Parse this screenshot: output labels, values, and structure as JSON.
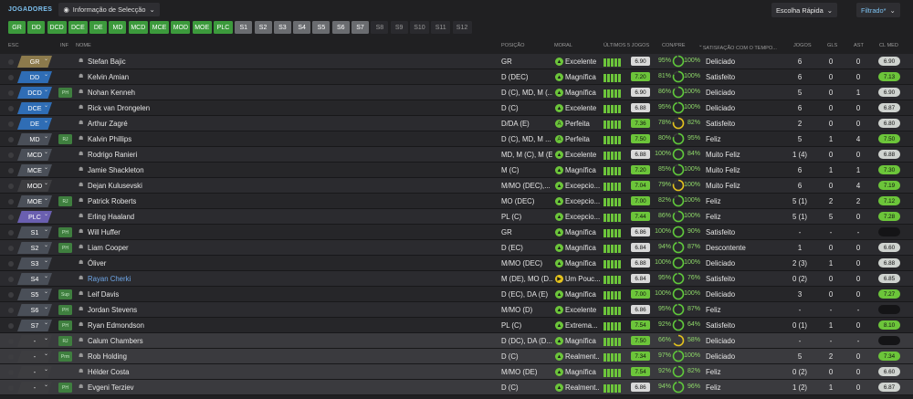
{
  "header": {
    "title": "JOGADORES",
    "view_label": "Informação de Selecção",
    "quick_pick": "Escolha Rápida",
    "filter": "Filtrado*"
  },
  "position_chips": [
    {
      "label": "GR",
      "style": "on"
    },
    {
      "label": "DD",
      "style": "on"
    },
    {
      "label": "DCD",
      "style": "on"
    },
    {
      "label": "DCE",
      "style": "on"
    },
    {
      "label": "DE",
      "style": "on"
    },
    {
      "label": "MD",
      "style": "on"
    },
    {
      "label": "MCD",
      "style": "on"
    },
    {
      "label": "MCE",
      "style": "on"
    },
    {
      "label": "MOD",
      "style": "on"
    },
    {
      "label": "MOE",
      "style": "on"
    },
    {
      "label": "PLC",
      "style": "on"
    },
    {
      "label": "S1",
      "style": "gr"
    },
    {
      "label": "S2",
      "style": "gr"
    },
    {
      "label": "S3",
      "style": "gr"
    },
    {
      "label": "S4",
      "style": "gr"
    },
    {
      "label": "S5",
      "style": "gr"
    },
    {
      "label": "S6",
      "style": "gr"
    },
    {
      "label": "S7",
      "style": "gr"
    },
    {
      "label": "S8",
      "style": "off"
    },
    {
      "label": "S9",
      "style": "off"
    },
    {
      "label": "S10",
      "style": "off"
    },
    {
      "label": "S11",
      "style": "off"
    },
    {
      "label": "S12",
      "style": "off"
    }
  ],
  "columns": {
    "esc": "ESC",
    "inf": "INF",
    "nome": "NOME",
    "posicao": "POSIÇÃO",
    "moral": "MORAL",
    "ultimos": "ÚLTIMOS 5 JOGOS",
    "conpre": "CON/PRE",
    "satisfacao": "SATISFAÇÃO COM O TEMPO...",
    "jogos": "JOGOS",
    "gls": "GLS",
    "ast": "AST",
    "clmed": "CL MED"
  },
  "colors": {
    "gk": "#8c7a4c",
    "def": "#2f6db5",
    "mid": "#4a4f58",
    "att": "#6a5fb0",
    "green": "#5fc83a",
    "yellow": "#e3c21d"
  },
  "players": [
    {
      "sel": "GR",
      "sel_color": "#8c7a4c",
      "inf": "",
      "name": "Stefan Bajic",
      "link": false,
      "pos": "GR",
      "moral": "Excelente",
      "moral_color": "#6cc53a",
      "moral_glyph": "▲",
      "bars": [
        9,
        9,
        9,
        9,
        9
      ],
      "form": "6.90",
      "form_color": "#d9d9d9",
      "con": "95%",
      "con_ring": 0.95,
      "pre": "100%",
      "sat": "Deliciado",
      "jogos": "6",
      "gls": "0",
      "ast": "0",
      "cl": "6.90",
      "cl_color": "#cfd3cf"
    },
    {
      "sel": "DD",
      "sel_color": "#2f6db5",
      "inf": "",
      "name": "Kelvin Amian",
      "link": false,
      "pos": "D (DEC)",
      "moral": "Magnífica",
      "moral_color": "#6cc53a",
      "moral_glyph": "▲",
      "bars": [
        9,
        9,
        9,
        9,
        9
      ],
      "form": "7.20",
      "form_color": "#6cc53a",
      "con": "81%",
      "con_ring": 0.81,
      "pre": "100%",
      "sat": "Satisfeito",
      "jogos": "6",
      "gls": "0",
      "ast": "0",
      "cl": "7.13",
      "cl_color": "#6cc53a"
    },
    {
      "sel": "DCD",
      "sel_color": "#2f6db5",
      "inf": "PH",
      "name": "Nohan Kenneh",
      "link": false,
      "pos": "D (C), MD, M (...",
      "moral": "Magnífica",
      "moral_color": "#6cc53a",
      "moral_glyph": "▲",
      "bars": [
        9,
        9,
        9,
        9,
        9
      ],
      "form": "6.90",
      "form_color": "#d9d9d9",
      "con": "86%",
      "con_ring": 0.86,
      "pre": "100%",
      "sat": "Deliciado",
      "jogos": "5",
      "gls": "0",
      "ast": "1",
      "cl": "6.90",
      "cl_color": "#cfd3cf"
    },
    {
      "sel": "DCE",
      "sel_color": "#2f6db5",
      "inf": "",
      "name": "Rick van Drongelen",
      "link": false,
      "pos": "D (C)",
      "moral": "Excelente",
      "moral_color": "#6cc53a",
      "moral_glyph": "▲",
      "bars": [
        9,
        9,
        9,
        9,
        9
      ],
      "form": "6.88",
      "form_color": "#d9d9d9",
      "con": "95%",
      "con_ring": 0.95,
      "pre": "100%",
      "sat": "Deliciado",
      "jogos": "6",
      "gls": "0",
      "ast": "0",
      "cl": "6.87",
      "cl_color": "#cfd3cf"
    },
    {
      "sel": "DE",
      "sel_color": "#2f6db5",
      "inf": "",
      "name": "Arthur Zagré",
      "link": false,
      "pos": "D/DA (E)",
      "moral": "Perfeita",
      "moral_color": "#6cc53a",
      "moral_glyph": "A",
      "bars": [
        9,
        9,
        9,
        9,
        9
      ],
      "form": "7.36",
      "form_color": "#6cc53a",
      "con": "78%",
      "con_ring": 0.78,
      "pre": "82%",
      "sat": "Satisfeito",
      "jogos": "2",
      "gls": "0",
      "ast": "0",
      "cl": "6.80",
      "cl_color": "#cfd3cf"
    },
    {
      "sel": "MD",
      "sel_color": "#4a4f58",
      "inf": "RJ",
      "name": "Kalvin Phillips",
      "link": false,
      "pos": "D (C), MD, M ...",
      "moral": "Perfeita",
      "moral_color": "#6cc53a",
      "moral_glyph": "A",
      "bars": [
        9,
        9,
        9,
        9,
        9
      ],
      "form": "7.50",
      "form_color": "#6cc53a",
      "con": "80%",
      "con_ring": 0.8,
      "pre": "95%",
      "sat": "Feliz",
      "jogos": "5",
      "gls": "1",
      "ast": "4",
      "cl": "7.50",
      "cl_color": "#6cc53a"
    },
    {
      "sel": "MCD",
      "sel_color": "#4a4f58",
      "inf": "",
      "name": "Rodrigo Ranieri",
      "link": false,
      "pos": "MD, M (C), M (E)...",
      "moral": "Excelente",
      "moral_color": "#6cc53a",
      "moral_glyph": "▲",
      "bars": [
        9,
        9,
        9,
        9,
        9
      ],
      "form": "6.88",
      "form_color": "#d9d9d9",
      "con": "100%",
      "con_ring": 1,
      "pre": "84%",
      "sat": "Muito Feliz",
      "jogos": "1 (4)",
      "gls": "0",
      "ast": "0",
      "cl": "6.88",
      "cl_color": "#cfd3cf"
    },
    {
      "sel": "MCE",
      "sel_color": "#4a4f58",
      "inf": "",
      "name": "Jamie Shackleton",
      "link": false,
      "pos": "M (C)",
      "moral": "Magnífica",
      "moral_color": "#6cc53a",
      "moral_glyph": "▲",
      "bars": [
        9,
        9,
        9,
        9,
        9
      ],
      "form": "7.20",
      "form_color": "#6cc53a",
      "con": "85%",
      "con_ring": 0.85,
      "pre": "100%",
      "sat": "Muito Feliz",
      "jogos": "6",
      "gls": "1",
      "ast": "1",
      "cl": "7.30",
      "cl_color": "#6cc53a"
    },
    {
      "sel": "MOD",
      "sel_color": "#3d3d40",
      "inf": "",
      "name": "Dejan Kulusevski",
      "link": false,
      "pos": "M/MO (DEC),...",
      "moral": "Excepcio...",
      "moral_color": "#6cc53a",
      "moral_glyph": "▲",
      "bars": [
        9,
        9,
        9,
        9,
        9
      ],
      "form": "7.04",
      "form_color": "#6cc53a",
      "con": "79%",
      "con_ring": 0.79,
      "pre": "100%",
      "sat": "Muito Feliz",
      "jogos": "6",
      "gls": "0",
      "ast": "4",
      "cl": "7.19",
      "cl_color": "#6cc53a"
    },
    {
      "sel": "MOE",
      "sel_color": "#4a4f58",
      "inf": "RJ",
      "name": "Patrick Roberts",
      "link": false,
      "pos": "MO (DEC)",
      "moral": "Excepcio...",
      "moral_color": "#6cc53a",
      "moral_glyph": "▲",
      "bars": [
        9,
        9,
        9,
        9,
        9
      ],
      "form": "7.00",
      "form_color": "#6cc53a",
      "con": "82%",
      "con_ring": 0.82,
      "pre": "100%",
      "sat": "Feliz",
      "jogos": "5 (1)",
      "gls": "2",
      "ast": "2",
      "cl": "7.12",
      "cl_color": "#6cc53a"
    },
    {
      "sel": "PLC",
      "sel_color": "#6a5fb0",
      "inf": "",
      "name": "Erling Haaland",
      "link": false,
      "pos": "PL (C)",
      "moral": "Excepcio...",
      "moral_color": "#6cc53a",
      "moral_glyph": "▲",
      "bars": [
        9,
        9,
        9,
        9,
        9
      ],
      "form": "7.44",
      "form_color": "#6cc53a",
      "con": "86%",
      "con_ring": 0.86,
      "pre": "100%",
      "sat": "Feliz",
      "jogos": "5 (1)",
      "gls": "5",
      "ast": "0",
      "cl": "7.28",
      "cl_color": "#6cc53a"
    },
    {
      "sel": "S1",
      "sel_color": "#4a4f58",
      "inf": "PH",
      "name": "Will Huffer",
      "link": false,
      "pos": "GR",
      "moral": "Magnífica",
      "moral_color": "#6cc53a",
      "moral_glyph": "▲",
      "bars": [
        9,
        9,
        9,
        9,
        9
      ],
      "form": "6.86",
      "form_color": "#d9d9d9",
      "con": "100%",
      "con_ring": 1,
      "pre": "90%",
      "sat": "Satisfeito",
      "jogos": "-",
      "gls": "-",
      "ast": "-",
      "cl": "",
      "cl_color": "#141416"
    },
    {
      "sel": "S2",
      "sel_color": "#4a4f58",
      "inf": "PH",
      "name": "Liam Cooper",
      "link": false,
      "pos": "D (EC)",
      "moral": "Magnífica",
      "moral_color": "#6cc53a",
      "moral_glyph": "▲",
      "bars": [
        9,
        9,
        9,
        9,
        9
      ],
      "form": "6.84",
      "form_color": "#d9d9d9",
      "con": "94%",
      "con_ring": 0.94,
      "pre": "87%",
      "sat": "Descontente",
      "jogos": "1",
      "gls": "0",
      "ast": "0",
      "cl": "6.60",
      "cl_color": "#cfd3cf"
    },
    {
      "sel": "S3",
      "sel_color": "#4a4f58",
      "inf": "",
      "name": "Óliver",
      "link": false,
      "pos": "M/MO (DEC)",
      "moral": "Magnífica",
      "moral_color": "#6cc53a",
      "moral_glyph": "▲",
      "bars": [
        9,
        9,
        9,
        9,
        9
      ],
      "form": "6.88",
      "form_color": "#d9d9d9",
      "con": "100%",
      "con_ring": 1,
      "pre": "100%",
      "sat": "Deliciado",
      "jogos": "2 (3)",
      "gls": "1",
      "ast": "0",
      "cl": "6.88",
      "cl_color": "#cfd3cf"
    },
    {
      "sel": "S4",
      "sel_color": "#4a4f58",
      "inf": "",
      "name": "Rayan Cherki",
      "link": true,
      "pos": "M (DE), MO (D...",
      "moral": "Um Pouc...",
      "moral_color": "#e3c21d",
      "moral_glyph": "▶",
      "bars": [
        9,
        9,
        9,
        9,
        9
      ],
      "form": "6.84",
      "form_color": "#d9d9d9",
      "con": "95%",
      "con_ring": 0.95,
      "pre": "76%",
      "sat": "Satisfeito",
      "jogos": "0 (2)",
      "gls": "0",
      "ast": "0",
      "cl": "6.85",
      "cl_color": "#cfd3cf"
    },
    {
      "sel": "S5",
      "sel_color": "#4a4f58",
      "inf": "Sup",
      "name": "Leif Davis",
      "link": false,
      "pos": "D (EC), DA (E)",
      "moral": "Magnífica",
      "moral_color": "#6cc53a",
      "moral_glyph": "▲",
      "bars": [
        9,
        9,
        9,
        9,
        9
      ],
      "form": "7.00",
      "form_color": "#6cc53a",
      "con": "100%",
      "con_ring": 1,
      "pre": "100%",
      "sat": "Deliciado",
      "jogos": "3",
      "gls": "0",
      "ast": "0",
      "cl": "7.27",
      "cl_color": "#6cc53a"
    },
    {
      "sel": "S6",
      "sel_color": "#4a4f58",
      "inf": "PH",
      "name": "Jordan Stevens",
      "link": false,
      "pos": "M/MO (D)",
      "moral": "Excelente",
      "moral_color": "#6cc53a",
      "moral_glyph": "▲",
      "bars": [
        9,
        9,
        9,
        9,
        9
      ],
      "form": "6.86",
      "form_color": "#d9d9d9",
      "con": "95%",
      "con_ring": 0.95,
      "pre": "87%",
      "sat": "Feliz",
      "jogos": "-",
      "gls": "-",
      "ast": "-",
      "cl": "",
      "cl_color": "#141416"
    },
    {
      "sel": "S7",
      "sel_color": "#4a4f58",
      "inf": "PH",
      "name": "Ryan Edmondson",
      "link": false,
      "pos": "PL (C)",
      "moral": "Extrema...",
      "moral_color": "#6cc53a",
      "moral_glyph": "▲",
      "bars": [
        9,
        9,
        9,
        9,
        9
      ],
      "form": "7.54",
      "form_color": "#6cc53a",
      "con": "92%",
      "con_ring": 0.92,
      "pre": "64%",
      "sat": "Satisfeito",
      "jogos": "0 (1)",
      "gls": "1",
      "ast": "0",
      "cl": "8.10",
      "cl_color": "#6cc53a"
    },
    {
      "sel": "-",
      "sel_color": "#3d3d40",
      "inf": "RJ",
      "name": "Calum Chambers",
      "link": false,
      "pos": "D (DC), DA (D...",
      "moral": "Magnífica",
      "moral_color": "#6cc53a",
      "moral_glyph": "▲",
      "bars": [
        9,
        9,
        9,
        9,
        9
      ],
      "form": "7.50",
      "form_color": "#6cc53a",
      "con": "66%",
      "con_ring": 0.66,
      "pre": "58%",
      "sat": "Deliciado",
      "jogos": "-",
      "gls": "-",
      "ast": "-",
      "cl": "",
      "cl_color": "#141416"
    },
    {
      "sel": "-",
      "sel_color": "#3d3d40",
      "inf": "Prm",
      "name": "Rob Holding",
      "link": false,
      "pos": "D (C)",
      "moral": "Realment...",
      "moral_color": "#6cc53a",
      "moral_glyph": "▲",
      "bars": [
        9,
        9,
        9,
        9,
        9
      ],
      "form": "7.34",
      "form_color": "#6cc53a",
      "con": "97%",
      "con_ring": 0.97,
      "pre": "100%",
      "sat": "Deliciado",
      "jogos": "5",
      "gls": "2",
      "ast": "0",
      "cl": "7.34",
      "cl_color": "#6cc53a"
    },
    {
      "sel": "-",
      "sel_color": "#3d3d40",
      "inf": "",
      "name": "Hélder Costa",
      "link": false,
      "pos": "M/MO (DE)",
      "moral": "Magnífica",
      "moral_color": "#6cc53a",
      "moral_glyph": "▲",
      "bars": [
        9,
        9,
        9,
        9,
        9
      ],
      "form": "7.54",
      "form_color": "#6cc53a",
      "con": "92%",
      "con_ring": 0.92,
      "pre": "82%",
      "sat": "Feliz",
      "jogos": "0 (2)",
      "gls": "0",
      "ast": "0",
      "cl": "6.60",
      "cl_color": "#cfd3cf"
    },
    {
      "sel": "-",
      "sel_color": "#3d3d40",
      "inf": "PH",
      "name": "Evgeni Terziev",
      "link": false,
      "pos": "D (C)",
      "moral": "Realment...",
      "moral_color": "#6cc53a",
      "moral_glyph": "▲",
      "bars": [
        9,
        9,
        9,
        9,
        9
      ],
      "form": "6.86",
      "form_color": "#d9d9d9",
      "con": "94%",
      "con_ring": 0.94,
      "pre": "96%",
      "sat": "Feliz",
      "jogos": "1 (2)",
      "gls": "1",
      "ast": "0",
      "cl": "6.87",
      "cl_color": "#cfd3cf"
    }
  ]
}
